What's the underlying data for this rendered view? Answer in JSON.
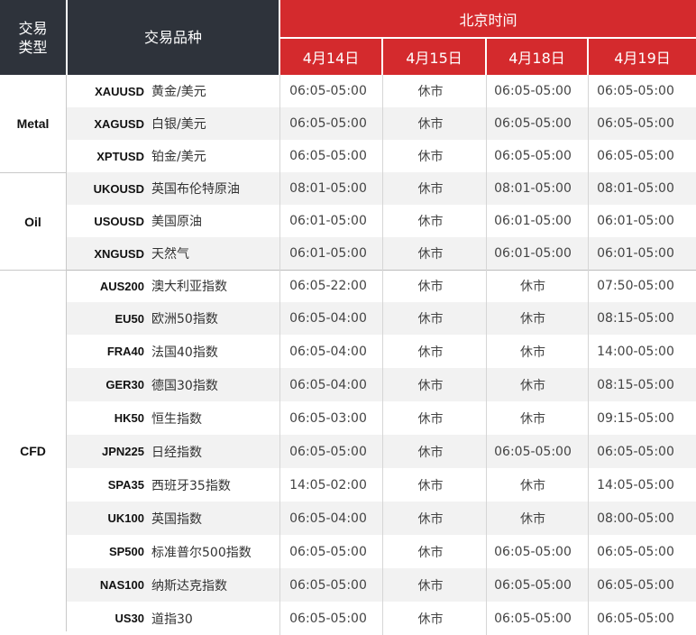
{
  "header": {
    "type_label": "交易类型",
    "product_label": "交易品种",
    "time_label": "北京时间",
    "dates": [
      "4月14日",
      "4月15日",
      "4月18日",
      "4月19日"
    ]
  },
  "categories": [
    "Metal",
    "Oil",
    "CFD"
  ],
  "rows": [
    {
      "code": "XAUUSD",
      "name": "黄金/美元",
      "t": [
        "06:05-05:00",
        "休市",
        "06:05-05:00",
        "06:05-05:00"
      ]
    },
    {
      "code": "XAGUSD",
      "name": "白银/美元",
      "t": [
        "06:05-05:00",
        "休市",
        "06:05-05:00",
        "06:05-05:00"
      ]
    },
    {
      "code": "XPTUSD",
      "name": "铂金/美元",
      "t": [
        "06:05-05:00",
        "休市",
        "06:05-05:00",
        "06:05-05:00"
      ]
    },
    {
      "code": "UKOUSD",
      "name": "英国布伦特原油",
      "t": [
        "08:01-05:00",
        "休市",
        "08:01-05:00",
        "08:01-05:00"
      ]
    },
    {
      "code": "USOUSD",
      "name": "美国原油",
      "t": [
        "06:01-05:00",
        "休市",
        "06:01-05:00",
        "06:01-05:00"
      ]
    },
    {
      "code": "XNGUSD",
      "name": "天然气",
      "t": [
        "06:01-05:00",
        "休市",
        "06:01-05:00",
        "06:01-05:00"
      ]
    },
    {
      "code": "AUS200",
      "name": "澳大利亚指数",
      "t": [
        "06:05-22:00",
        "休市",
        "休市",
        "07:50-05:00"
      ]
    },
    {
      "code": "EU50",
      "name": "欧洲50指数",
      "t": [
        "06:05-04:00",
        "休市",
        "休市",
        "08:15-05:00"
      ]
    },
    {
      "code": "FRA40",
      "name": "法国40指数",
      "t": [
        "06:05-04:00",
        "休市",
        "休市",
        "14:00-05:00"
      ]
    },
    {
      "code": "GER30",
      "name": "德国30指数",
      "t": [
        "06:05-04:00",
        "休市",
        "休市",
        "08:15-05:00"
      ]
    },
    {
      "code": "HK50",
      "name": "恒生指数",
      "t": [
        "06:05-03:00",
        "休市",
        "休市",
        "09:15-05:00"
      ]
    },
    {
      "code": "JPN225",
      "name": "日经指数",
      "t": [
        "06:05-05:00",
        "休市",
        "06:05-05:00",
        "06:05-05:00"
      ]
    },
    {
      "code": "SPA35",
      "name": "西班牙35指数",
      "t": [
        "14:05-02:00",
        "休市",
        "休市",
        "14:05-05:00"
      ]
    },
    {
      "code": "UK100",
      "name": "英国指数",
      "t": [
        "06:05-04:00",
        "休市",
        "休市",
        "08:00-05:00"
      ]
    },
    {
      "code": "SP500",
      "name": "标准普尔500指数",
      "t": [
        "06:05-05:00",
        "休市",
        "06:05-05:00",
        "06:05-05:00"
      ]
    },
    {
      "code": "NAS100",
      "name": "纳斯达克指数",
      "t": [
        "06:05-05:00",
        "休市",
        "06:05-05:00",
        "06:05-05:00"
      ]
    },
    {
      "code": "US30",
      "name": "道指30",
      "t": [
        "06:05-05:00",
        "休市",
        "06:05-05:00",
        "06:05-05:00"
      ]
    }
  ],
  "colors": {
    "header_dark": "#2e333b",
    "header_red": "#d42a2d",
    "row_alt": "#f2f2f2"
  }
}
